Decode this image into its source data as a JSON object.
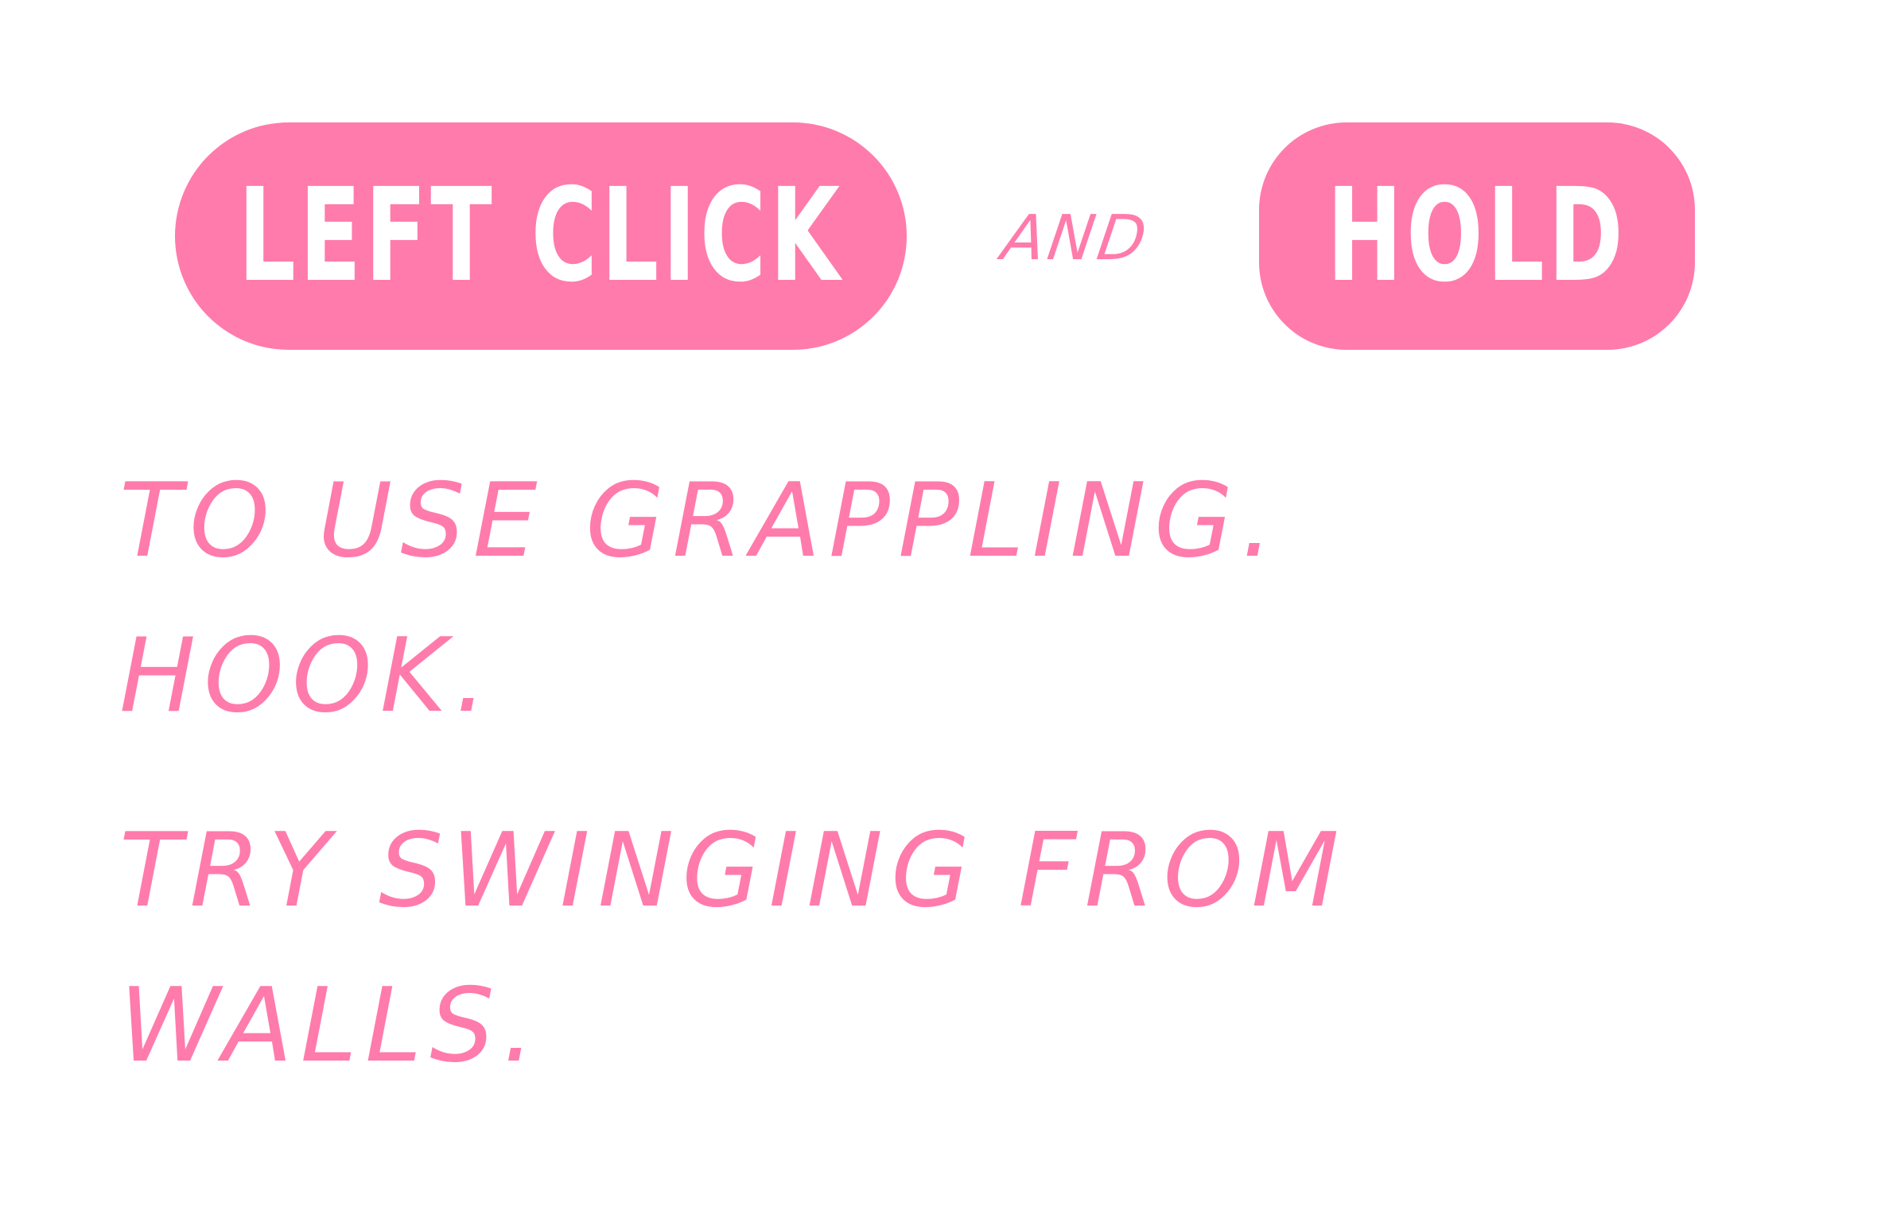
{
  "controls": {
    "primary_input": "LEFT CLICK",
    "connector": "AND",
    "secondary_input": "HOLD"
  },
  "instructions": {
    "grapple": "TO USE GRAPPLING.\nHOOK.",
    "swing": "TRY SWINGING FROM\nWALLS."
  },
  "colors": {
    "accent": "#ff7bab",
    "text_on_accent": "#ffffff",
    "background": "#ffffff"
  }
}
